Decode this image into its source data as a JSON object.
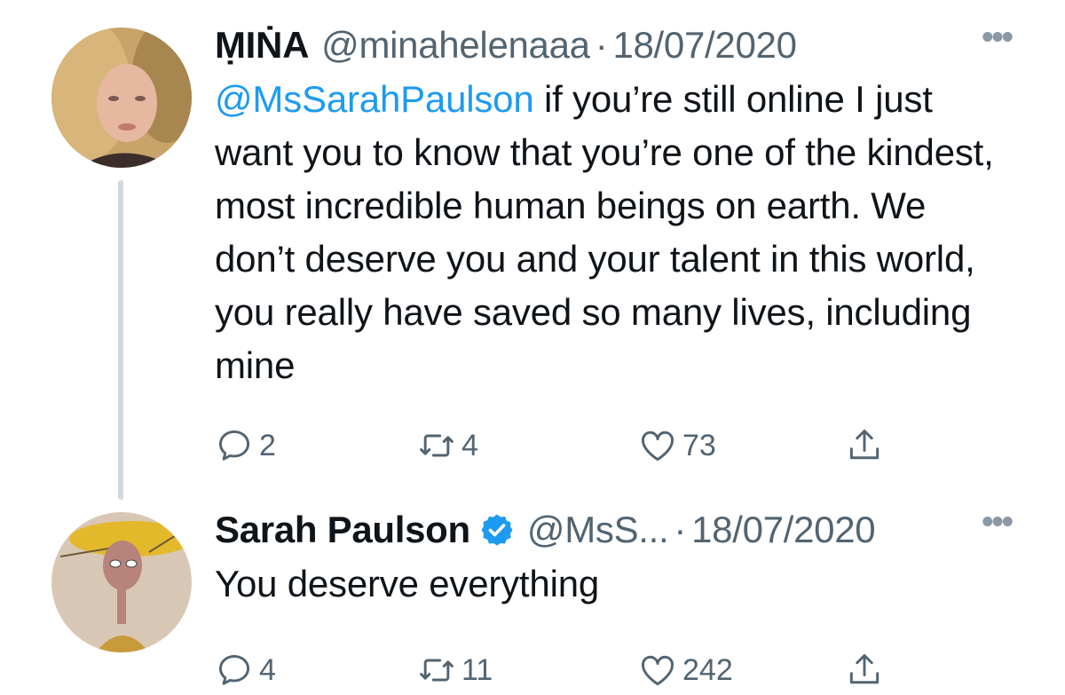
{
  "tweets": [
    {
      "name": "ṂIṄA",
      "handle": "@minahelenaaa",
      "separator": "·",
      "date": "18/07/2020",
      "more": "•••",
      "mention": "@MsSarahPaulson",
      "text": " if you’re still online I just want you to know that you’re one of the kindest, most incredible human beings on earth. We don’t deserve you and your talent in this world, you really have saved so many lives, including mine",
      "replies": "2",
      "retweets": "4",
      "likes": "73",
      "verified": false
    },
    {
      "name": "Sarah Paulson",
      "handle": "@MsS...",
      "separator": "·",
      "date": "18/07/2020",
      "more": "•••",
      "text": "You deserve everything",
      "replies": "4",
      "retweets": "11",
      "likes": "242",
      "verified": true
    }
  ],
  "icons": {
    "reply": "reply-icon",
    "retweet": "retweet-icon",
    "like": "heart-icon",
    "share": "share-icon",
    "verified": "verified-badge-icon"
  },
  "colors": {
    "text": "#0f1419",
    "secondary": "#536471",
    "link": "#1d9bf0",
    "thread_line": "#cfd9de"
  }
}
